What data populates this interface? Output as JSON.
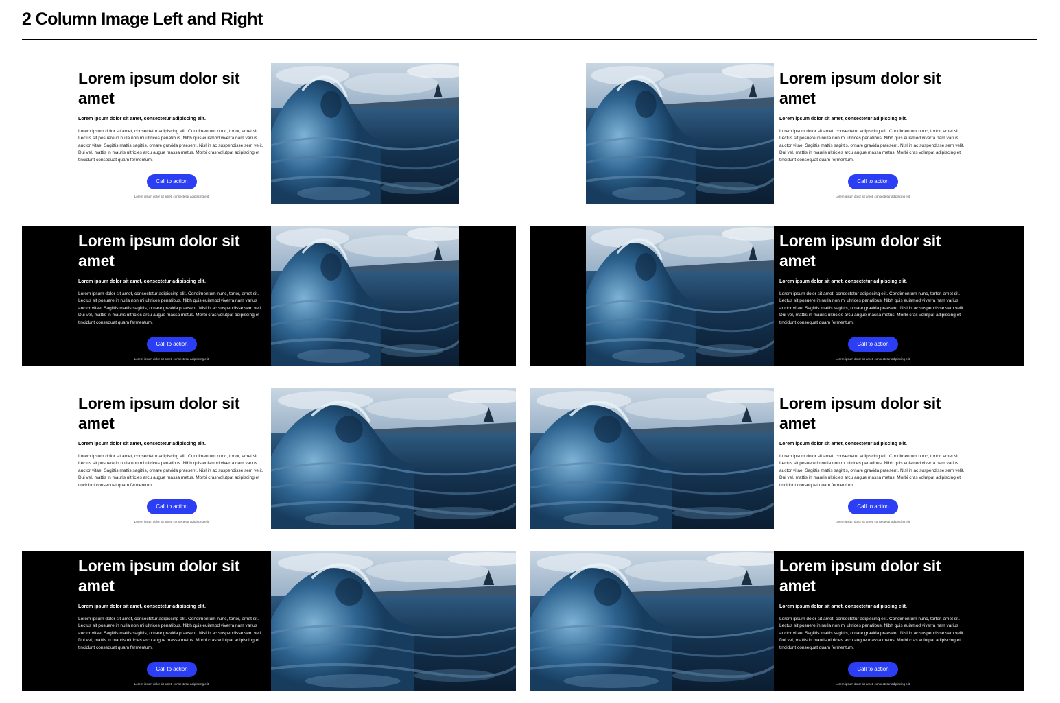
{
  "page": {
    "title": "2 Column Image Left and Right"
  },
  "colors": {
    "cta_background": "#2b3ef3",
    "dark_background": "#000000",
    "light_background": "#ffffff"
  },
  "image": {
    "description_icon": "ocean-wave-image"
  },
  "cards": [
    {
      "headline": "Lorem ipsum dolor sit amet",
      "subhead": "Lorem ipsum dolor sit amet, consectetur adipiscing elit.",
      "body": "Lorem ipsum dolor sit amet, consectetur adipiscing elit. Condimentum nunc, tortor, amet sit. Lectus sit posuere in nulla non mi ultrices penatibus. Nibh quis euismod viverra nam varius auctor vitae. Sagittis mattis sagittis, ornare gravida praesent. Nisl in ac suspendisse sem velit. Dui vel, mattis in mauris ultricies arcu augue massa metus. Morbi cras volutpat adipiscing et tincidunt consequat quam fermentum.",
      "cta": "Call to action",
      "fine_print": "Lorem ipsum dolor sit amet, consectetur adipiscing elit."
    },
    {
      "headline": "Lorem ipsum dolor sit amet",
      "subhead": "Lorem ipsum dolor sit amet, consectetur adipiscing elit.",
      "body": "Lorem ipsum dolor sit amet, consectetur adipiscing elit. Condimentum nunc, tortor, amet sit. Lectus sit posuere in nulla non mi ultrices penatibus. Nibh quis euismod viverra nam varius auctor vitae. Sagittis mattis sagittis, ornare gravida praesent. Nisl in ac suspendisse sem velit. Dui vel, mattis in mauris ultricies arcu augue massa metus. Morbi cras volutpat adipiscing et tincidunt consequat quam fermentum.",
      "cta": "Call to action",
      "fine_print": "Lorem ipsum dolor sit amet, consectetur adipiscing elit."
    },
    {
      "headline": "Lorem ipsum dolor sit amet",
      "subhead": "Lorem ipsum dolor sit amet, consectetur adipiscing elit.",
      "body": "Lorem ipsum dolor sit amet, consectetur adipiscing elit. Condimentum nunc, tortor, amet sit. Lectus sit posuere in nulla non mi ultrices penatibus. Nibh quis euismod viverra nam varius auctor vitae. Sagittis mattis sagittis, ornare gravida praesent. Nisl in ac suspendisse sem velit. Dui vel, mattis in mauris ultricies arcu augue massa metus. Morbi cras volutpat adipiscing et tincidunt consequat quam fermentum.",
      "cta": "Call to action",
      "fine_print": "Lorem ipsum dolor sit amet, consectetur adipiscing elit."
    },
    {
      "headline": "Lorem ipsum dolor sit amet",
      "subhead": "Lorem ipsum dolor sit amet, consectetur adipiscing elit.",
      "body": "Lorem ipsum dolor sit amet, consectetur adipiscing elit. Condimentum nunc, tortor, amet sit. Lectus sit posuere in nulla non mi ultrices penatibus. Nibh quis euismod viverra nam varius auctor vitae. Sagittis mattis sagittis, ornare gravida praesent. Nisl in ac suspendisse sem velit. Dui vel, mattis in mauris ultricies arcu augue massa metus. Morbi cras volutpat adipiscing et tincidunt consequat quam fermentum.",
      "cta": "Call to action",
      "fine_print": "Lorem ipsum dolor sit amet, consectetur adipiscing elit."
    },
    {
      "headline": "Lorem ipsum dolor sit amet",
      "subhead": "Lorem ipsum dolor sit amet, consectetur adipiscing elit.",
      "body": "Lorem ipsum dolor sit amet, consectetur adipiscing elit. Condimentum nunc, tortor, amet sit. Lectus sit posuere in nulla non mi ultrices penatibus. Nibh quis euismod viverra nam varius auctor vitae. Sagittis mattis sagittis, ornare gravida praesent. Nisl in ac suspendisse sem velit. Dui vel, mattis in mauris ultricies arcu augue massa metus. Morbi cras volutpat adipiscing et tincidunt consequat quam fermentum.",
      "cta": "Call to action",
      "fine_print": "Lorem ipsum dolor sit amet, consectetur adipiscing elit."
    },
    {
      "headline": "Lorem ipsum dolor sit amet",
      "subhead": "Lorem ipsum dolor sit amet, consectetur adipiscing elit.",
      "body": "Lorem ipsum dolor sit amet, consectetur adipiscing elit. Condimentum nunc, tortor, amet sit. Lectus sit posuere in nulla non mi ultrices penatibus. Nibh quis euismod viverra nam varius auctor vitae. Sagittis mattis sagittis, ornare gravida praesent. Nisl in ac suspendisse sem velit. Dui vel, mattis in mauris ultricies arcu augue massa metus. Morbi cras volutpat adipiscing et tincidunt consequat quam fermentum.",
      "cta": "Call to action",
      "fine_print": "Lorem ipsum dolor sit amet, consectetur adipiscing elit."
    },
    {
      "headline": "Lorem ipsum dolor sit amet",
      "subhead": "Lorem ipsum dolor sit amet, consectetur adipiscing elit.",
      "body": "Lorem ipsum dolor sit amet, consectetur adipiscing elit. Condimentum nunc, tortor, amet sit. Lectus sit posuere in nulla non mi ultrices penatibus. Nibh quis euismod viverra nam varius auctor vitae. Sagittis mattis sagittis, ornare gravida praesent. Nisl in ac suspendisse sem velit. Dui vel, mattis in mauris ultricies arcu augue massa metus. Morbi cras volutpat adipiscing et tincidunt consequat quam fermentum.",
      "cta": "Call to action",
      "fine_print": "Lorem ipsum dolor sit amet, consectetur adipiscing elit."
    },
    {
      "headline": "Lorem ipsum dolor sit amet",
      "subhead": "Lorem ipsum dolor sit amet, consectetur adipiscing elit.",
      "body": "Lorem ipsum dolor sit amet, consectetur adipiscing elit. Condimentum nunc, tortor, amet sit. Lectus sit posuere in nulla non mi ultrices penatibus. Nibh quis euismod viverra nam varius auctor vitae. Sagittis mattis sagittis, ornare gravida praesent. Nisl in ac suspendisse sem velit. Dui vel, mattis in mauris ultricies arcu augue massa metus. Morbi cras volutpat adipiscing et tincidunt consequat quam fermentum.",
      "cta": "Call to action",
      "fine_print": "Lorem ipsum dolor sit amet, consectetur adipiscing elit."
    }
  ]
}
